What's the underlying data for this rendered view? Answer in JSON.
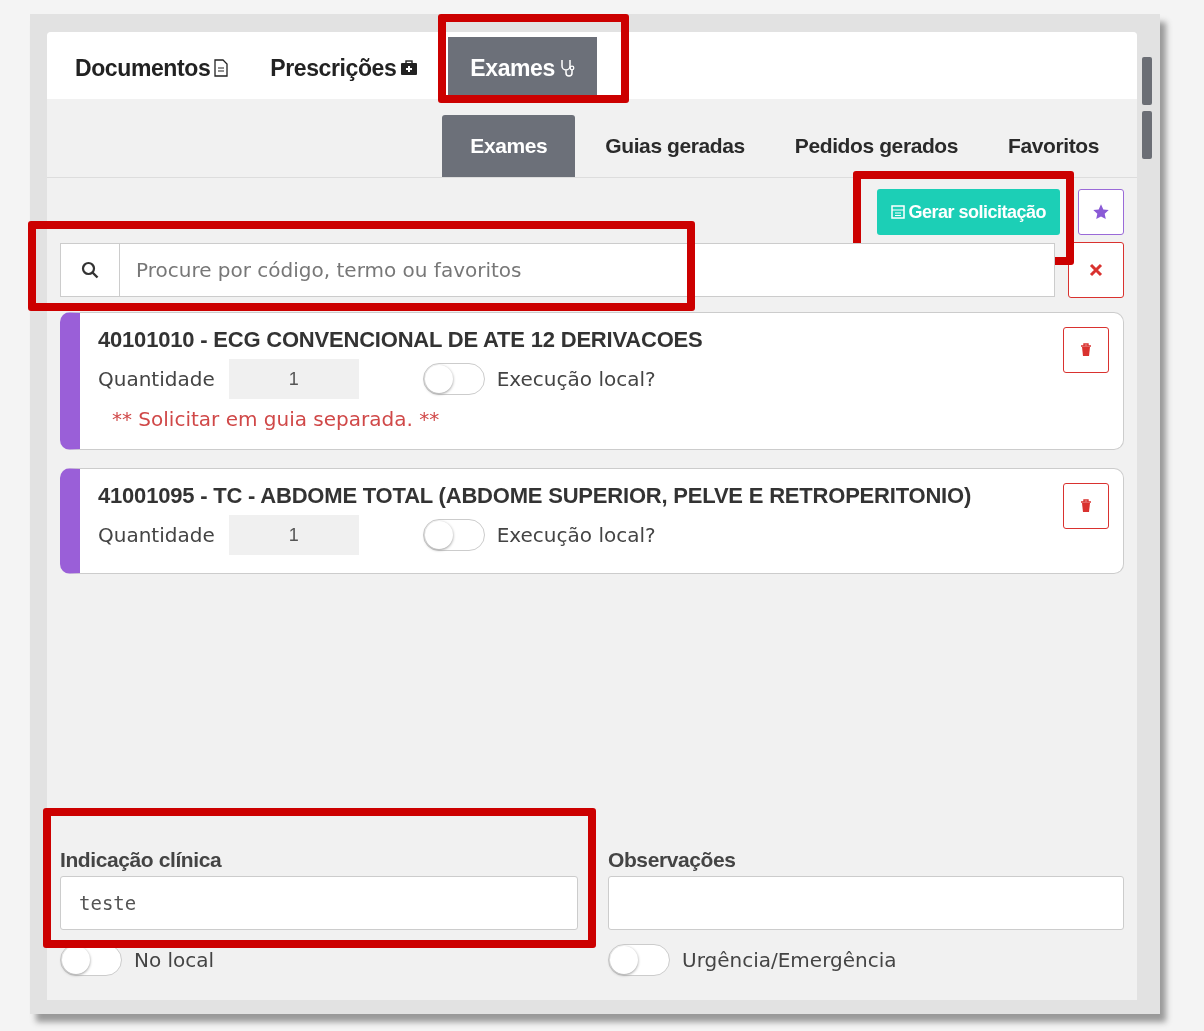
{
  "tabs": [
    {
      "label": "Documentos",
      "selected": false,
      "highlighted": false
    },
    {
      "label": "Prescrições",
      "selected": false,
      "highlighted": false
    },
    {
      "label": "Exames",
      "selected": true,
      "highlighted": true
    }
  ],
  "subtabs": [
    {
      "label": "Exames",
      "selected": true
    },
    {
      "label": "Guias geradas",
      "selected": false
    },
    {
      "label": "Pedidos gerados",
      "selected": false
    },
    {
      "label": "Favoritos",
      "selected": false
    }
  ],
  "generate_button": {
    "label": "Gerar solicitação",
    "highlighted": true
  },
  "search": {
    "placeholder": "Procure por código, termo ou favoritos",
    "highlighted": true
  },
  "exams": [
    {
      "title": "40101010 - ECG CONVENCIONAL DE ATE 12 DERIVACOES",
      "quantity_label": "Quantidade",
      "quantity": "1",
      "local_execution": {
        "label": "Execução local?",
        "on": false
      },
      "note": "** Solicitar em guia separada. **"
    },
    {
      "title": "41001095 - TC - ABDOME TOTAL (ABDOME SUPERIOR, PELVE E RETROPERITONIO)",
      "quantity_label": "Quantidade",
      "quantity": "1",
      "local_execution": {
        "label": "Execução local?",
        "on": false
      }
    }
  ],
  "fields": [
    {
      "label": "Indicação clínica",
      "value": "teste",
      "highlighted": true,
      "toggle": {
        "label": "No local",
        "on": false
      }
    },
    {
      "label": "Observações",
      "highlighted": false,
      "toggle": {
        "label": "Urgência/Emergência",
        "on": false
      }
    }
  ]
}
